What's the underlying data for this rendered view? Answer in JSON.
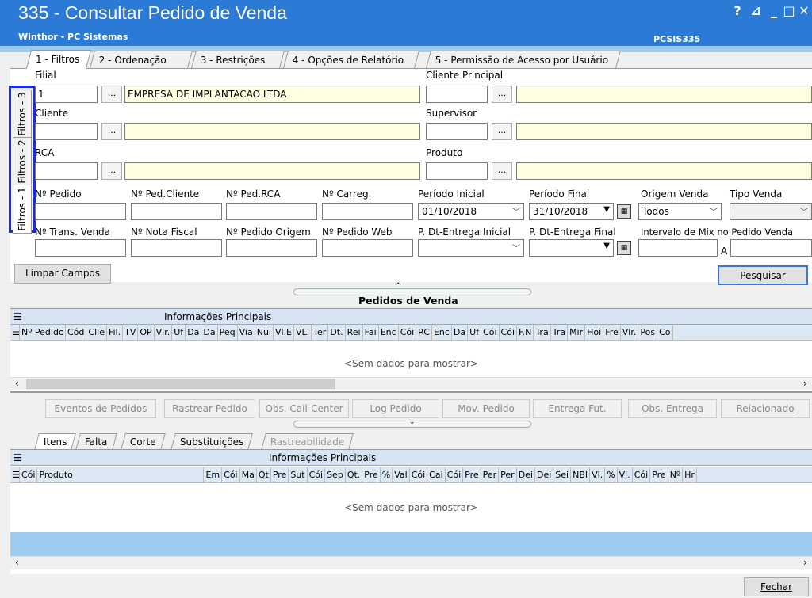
{
  "window": {
    "title": "335 - Consultar Pedido de Venda",
    "subtitle": "Winthor - PC Sistemas",
    "code": "PCSIS335",
    "help": "?",
    "restore": "⊿",
    "minimize": "_",
    "maximize": "□",
    "close": "✕"
  },
  "tabs": [
    "1 - Filtros",
    "2 - Ordenação",
    "3 - Restrições",
    "4 - Opções de Relatório",
    "5 - Permissão de Acesso por Usuário"
  ],
  "side_tabs": [
    "Filtros - 3",
    "Filtros - 2",
    "Filtros - 1"
  ],
  "filters": {
    "filial_label": "Filial",
    "filial_code": "1",
    "filial_name": "EMPRESA DE IMPLANTACAO LTDA",
    "cliente_principal_label": "Cliente Principal",
    "cliente_label": "Cliente",
    "supervisor_label": "Supervisor",
    "rca_label": "RCA",
    "produto_label": "Produto",
    "lookup_button": "...",
    "num_pedido_label": "Nº Pedido",
    "num_ped_cliente_label": "Nº Ped.Cliente",
    "num_ped_rca_label": "Nº Ped.RCA",
    "num_carreg_label": "Nº Carreg.",
    "periodo_inicial_label": "Período Inicial",
    "periodo_inicial_value": "01/10/2018",
    "periodo_final_label": "Período Final",
    "periodo_final_value": "31/10/2018",
    "origem_venda_label": "Origem Venda",
    "origem_venda_value": "Todos",
    "tipo_venda_label": "Tipo Venda",
    "num_trans_venda_label": "Nº Trans. Venda",
    "num_nota_fiscal_label": "Nº Nota Fiscal",
    "num_pedido_origem_label": "Nº Pedido Origem",
    "num_pedido_web_label": "Nº Pedido Web",
    "p_dt_entrega_inicial_label": "P. Dt-Entrega Inicial",
    "p_dt_entrega_final_label": "P. Dt-Entrega Final",
    "intervalo_mix_label": "Intervalo de Mix no Pedido Venda",
    "intervalo_sep": "A"
  },
  "buttons": {
    "limpar": "Limpar Campos",
    "pesquisar": "Pesquisar",
    "fechar": "Fechar"
  },
  "orders_grid": {
    "title": "Pedidos de  Venda",
    "group_header": "Informações Principais",
    "columns": [
      "Nº Pedido",
      "Cód",
      "Clie",
      "Fil.",
      "TV",
      "OP",
      "Vlr.",
      "Uf",
      "Da",
      "Da",
      "Peq",
      "Via",
      "Nui",
      "Vl.E",
      "VL.",
      "Ter",
      "Dt.",
      "Rei",
      "Fai",
      "Enc",
      "Cói",
      "RC",
      "Enc",
      "Da",
      "Uf",
      "Cói",
      "Cói",
      "F.N",
      "Tra",
      "Tra",
      "Mir",
      "Hoi",
      "Fre",
      "Vlr.",
      "Pos",
      "Co"
    ],
    "empty": "<Sem dados para mostrar>"
  },
  "actions": [
    "Eventos de Pedidos",
    "Rastrear Pedido",
    "Obs. Call-Center",
    "Log Pedido",
    "Mov. Pedido",
    "Entrega Fut.",
    "Obs. Entrega",
    "Relacionado"
  ],
  "bottom_tabs": [
    "Itens",
    "Falta",
    "Corte",
    "Substituições",
    "Rastreabilidade"
  ],
  "items_grid": {
    "group_header": "Informações Principais",
    "columns": [
      "Cói",
      "Produto",
      "Em",
      "Cói",
      "Ma",
      "Qt",
      "Pre",
      "Sut",
      "Cói",
      "Sep",
      "Qt.",
      "Pre",
      "%",
      "Val",
      "Cói",
      "Cai",
      "Cói",
      "Pre",
      "Per",
      "Per",
      "Dei",
      "Dei",
      "Sei",
      "NBI",
      "Vl.",
      "%",
      "Vl.",
      "Cói",
      "Pre",
      "Nº",
      "Hr"
    ],
    "empty": "<Sem dados para mostrar>"
  },
  "colors": {
    "titlebar": "#2b7bd6",
    "highlight": "#1a2bd9",
    "grid_band": "#9ecbf0"
  }
}
